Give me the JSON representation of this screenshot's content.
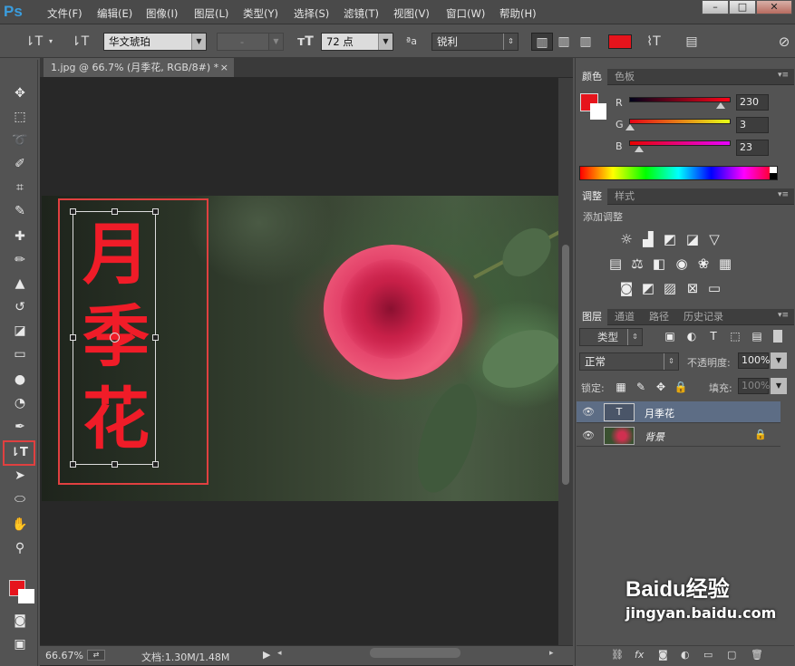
{
  "app": {
    "logo": "Ps",
    "menu": [
      "文件(F)",
      "编辑(E)",
      "图像(I)",
      "图层(L)",
      "类型(Y)",
      "选择(S)",
      "滤镜(T)",
      "视图(V)",
      "窗口(W)",
      "帮助(H)"
    ]
  },
  "options": {
    "font_family": "华文琥珀",
    "font_style": "-",
    "font_size": "72 点",
    "aa_label": "ªa",
    "aa_mode": "锐利",
    "text_color": "#e6141c"
  },
  "document": {
    "tab_title": "1.jpg @ 66.7% (月季花, RGB/8#) *",
    "tab_close": "×",
    "zoom": "66.67%",
    "doc_info": "文档:1.30M/1.48M",
    "text_chars": [
      "月",
      "季",
      "花"
    ]
  },
  "color_panel": {
    "tabs": [
      "颜色",
      "色板"
    ],
    "fg": "#e6141c",
    "bg": "#ffffff",
    "r": {
      "label": "R",
      "value": "230"
    },
    "g": {
      "label": "G",
      "value": "3"
    },
    "b": {
      "label": "B",
      "value": "23"
    }
  },
  "adjust_panel": {
    "tabs": [
      "调整",
      "样式"
    ],
    "title": "添加调整"
  },
  "layers_panel": {
    "tabs": [
      "图层",
      "通道",
      "路径",
      "历史记录"
    ],
    "filter_kind": "类型",
    "blend_mode": "正常",
    "opacity_label": "不透明度:",
    "opacity": "100%",
    "lock_label": "锁定:",
    "fill_label": "填充:",
    "fill": "100%",
    "layers": [
      {
        "name": "月季花",
        "type": "T"
      },
      {
        "name": "背景",
        "locked": true
      }
    ]
  },
  "watermark": {
    "brand": "Baidu经验",
    "url": "jingyan.baidu.com"
  }
}
